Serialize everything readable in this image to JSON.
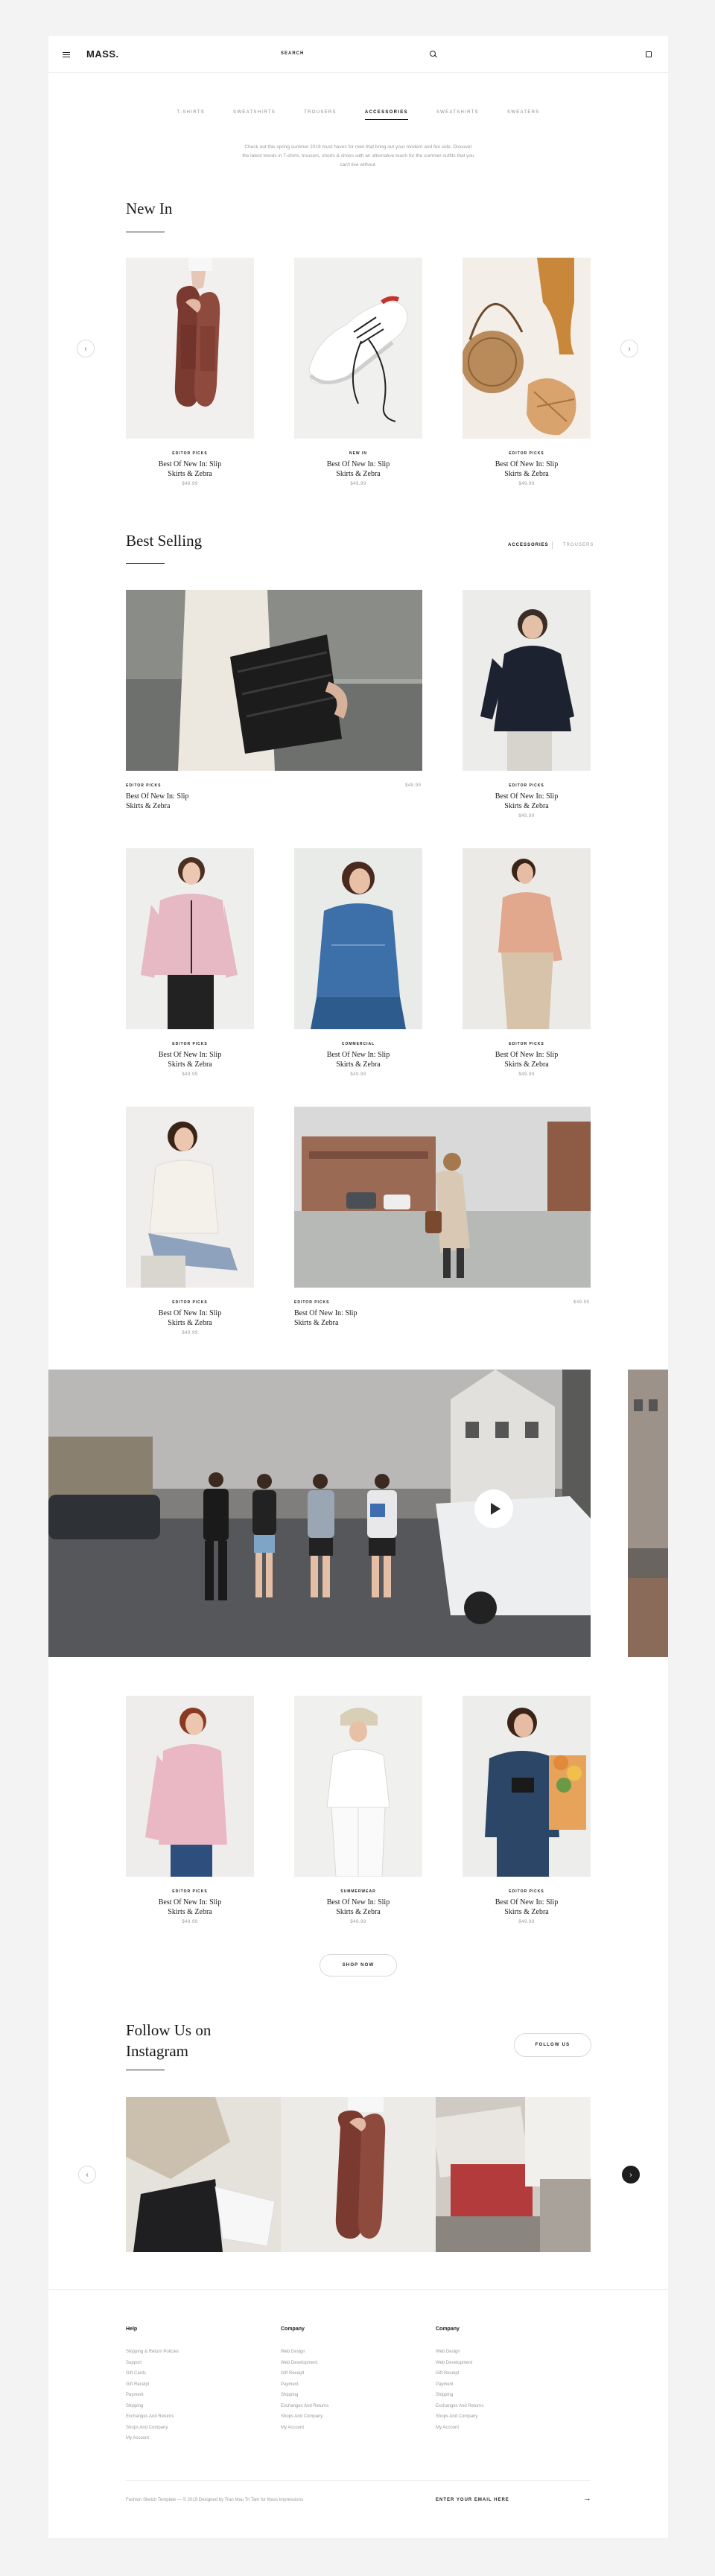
{
  "header": {
    "logo": "MASS.",
    "search_label": "SEARCH"
  },
  "categories": [
    {
      "label": "T-SHIRTS",
      "active": false
    },
    {
      "label": "SWEATSHIRTS",
      "active": false
    },
    {
      "label": "TROUSERS",
      "active": false
    },
    {
      "label": "ACCESSORIES",
      "active": true
    },
    {
      "label": "SWEATSHIRTS",
      "active": false
    },
    {
      "label": "SWEATERS",
      "active": false
    }
  ],
  "intro": "Check out this spring summer 2019 must haves for men that bring out your modern and fun side. Discover the latest trends in T-shirts, trousers, shorts & shoes with an alternative touch for the summer outfits that you can't live without.",
  "new_in": {
    "title": "New In",
    "items": [
      {
        "brand": "EDITOR PICKS",
        "name_line1": "Best Of New In: Slip",
        "name_line2": "Skirts & Zebra",
        "price": "$49.99"
      },
      {
        "brand": "NEW IN",
        "name_line1": "Best Of New In: Slip",
        "name_line2": "Skirts & Zebra",
        "price": "$49.99"
      },
      {
        "brand": "EDITOR PICKS",
        "name_line1": "Best Of New In: Slip",
        "name_line2": "Skirts & Zebra",
        "price": "$49.99"
      }
    ]
  },
  "best_selling": {
    "title": "Best Selling",
    "filter_active": "ACCESSORIES",
    "filter_other": "TROUSERS",
    "items": [
      {
        "brand": "EDITOR PICKS",
        "name_line1": "Best Of New In: Slip",
        "name_line2": "Skirts & Zebra",
        "price": "$49.99"
      },
      {
        "brand": "EDITOR PICKS",
        "name_line1": "Best Of New In: Slip",
        "name_line2": "Skirts & Zebra",
        "price": "$49.99"
      },
      {
        "brand": "EDITOR PICKS",
        "name_line1": "Best Of New In: Slip",
        "name_line2": "Skirts & Zebra",
        "price": "$49.99"
      },
      {
        "brand": "COMMERCIAL",
        "name_line1": "Best Of New In: Slip",
        "name_line2": "Skirts & Zebra",
        "price": "$49.99"
      },
      {
        "brand": "EDITOR PICKS",
        "name_line1": "Best Of New In: Slip",
        "name_line2": "Skirts & Zebra",
        "price": "$49.99"
      },
      {
        "brand": "EDITOR PICKS",
        "name_line1": "Best Of New In: Slip",
        "name_line2": "Skirts & Zebra",
        "price": "$49.99"
      },
      {
        "brand": "EDITOR PICKS",
        "name_line1": "Best Of New In: Slip",
        "name_line2": "Skirts & Zebra",
        "price": "$49.99"
      }
    ]
  },
  "after_video": {
    "items": [
      {
        "brand": "EDITOR PICKS",
        "name_line1": "Best Of New In: Slip",
        "name_line2": "Skirts & Zebra",
        "price": "$49.99"
      },
      {
        "brand": "SUMMERWEAR",
        "name_line1": "Best Of New In: Slip",
        "name_line2": "Skirts & Zebra",
        "price": "$49.99"
      },
      {
        "brand": "EDITOR PICKS",
        "name_line1": "Best Of New In: Slip",
        "name_line2": "Skirts & Zebra",
        "price": "$49.99"
      }
    ],
    "shop_now": "SHOP NOW"
  },
  "instagram": {
    "title_line1": "Follow Us on",
    "title_line2": "Instagram",
    "follow_button": "FOLLOW US"
  },
  "footer": {
    "columns": [
      {
        "title": "Help",
        "links": [
          "Shipping & Return Policies",
          "Support",
          "Gift Cards",
          "Gift Receipt",
          "Payment",
          "Shipping",
          "Exchanges And Returns",
          "Shops And Company",
          "My Account"
        ]
      },
      {
        "title": "Company",
        "links": [
          "Web Design",
          "Web Development",
          "Gift Receipt",
          "Payment",
          "Shipping",
          "Exchanges And Returns",
          "Shops And Company",
          "My Account"
        ]
      },
      {
        "title": "Company",
        "links": [
          "Web Design",
          "Web Development",
          "Gift Receipt",
          "Payment",
          "Shipping",
          "Exchanges And Returns",
          "Shops And Company",
          "My Account"
        ]
      }
    ],
    "copyright": "Fashion Sketch Template — © 2019 Designed by Tran Mau Tri Tam for Mass Impressions",
    "email_label": "ENTER YOUR EMAIL HERE",
    "submit_arrow": "→"
  },
  "colors": {
    "accent": "#1d1d1d",
    "background": "#f2f3f2",
    "muted_text": "#9a9a9a"
  }
}
